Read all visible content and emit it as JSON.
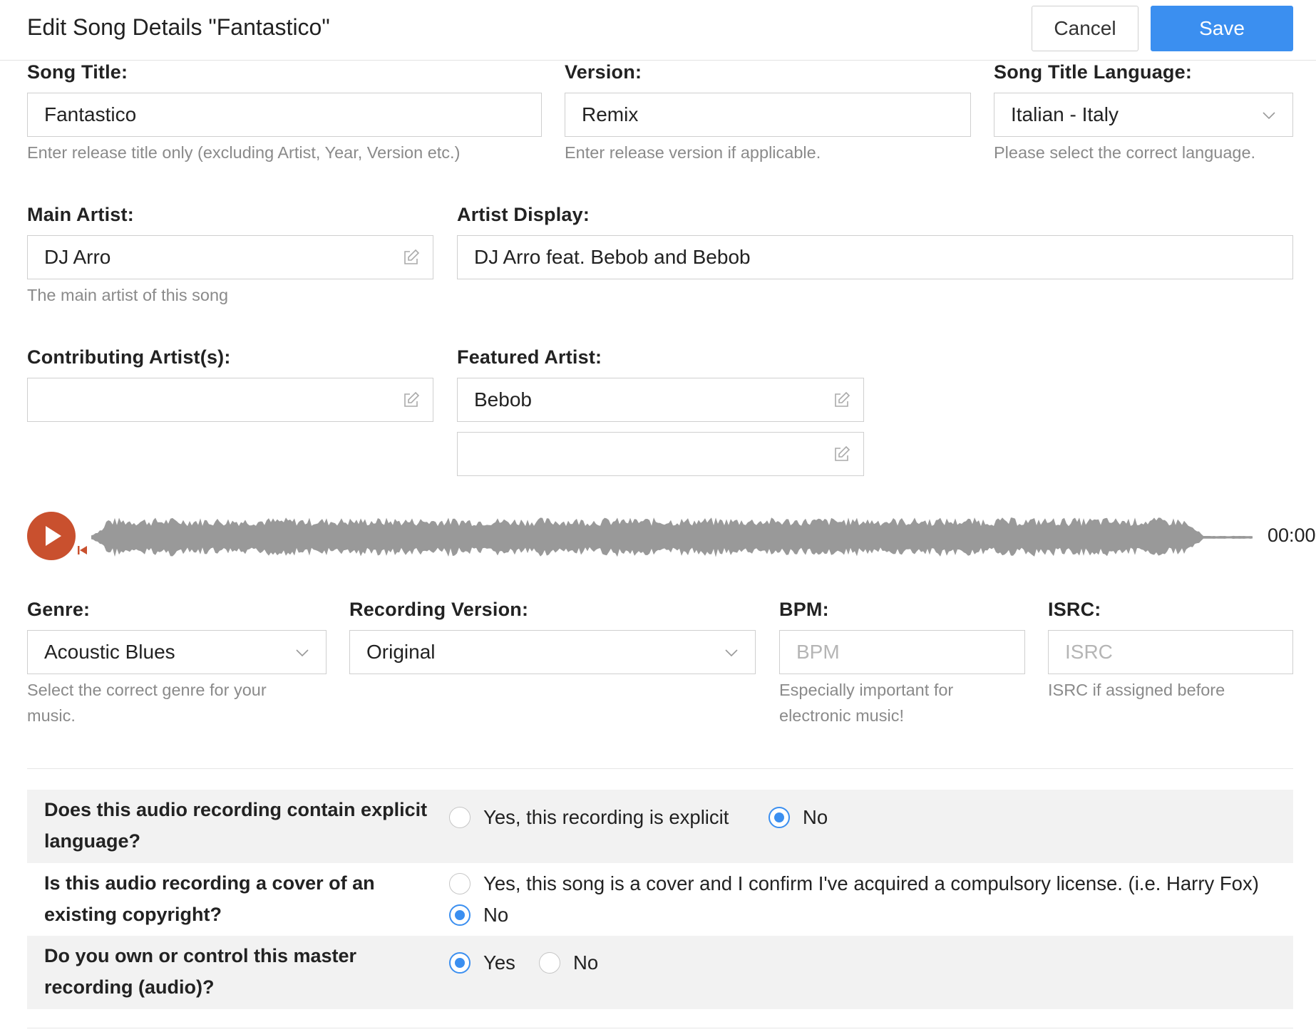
{
  "header": {
    "title": "Edit Song Details \"Fantastico\"",
    "cancel_label": "Cancel",
    "save_label": "Save"
  },
  "song_title": {
    "label": "Song Title:",
    "value": "Fantastico",
    "help": "Enter release title only (excluding Artist, Year, Version etc.)"
  },
  "version": {
    "label": "Version:",
    "value": "Remix",
    "help": "Enter release version if applicable."
  },
  "language": {
    "label": "Song Title Language:",
    "value": "Italian - Italy",
    "help": "Please select the correct language."
  },
  "main_artist": {
    "label": "Main Artist:",
    "value": "DJ Arro",
    "help": "The main artist of this song"
  },
  "artist_display": {
    "label": "Artist Display:",
    "value": "DJ Arro feat. Bebob and Bebob"
  },
  "contributing": {
    "label": "Contributing Artist(s):",
    "value": ""
  },
  "featured": {
    "label": "Featured Artist:",
    "values": [
      "Bebob",
      ""
    ]
  },
  "player": {
    "time": "00:00",
    "colors": {
      "play": "#c9502e",
      "wave": "#999999"
    }
  },
  "genre": {
    "label": "Genre:",
    "value": "Acoustic Blues",
    "help_line1": "Select the correct genre for your",
    "help_line2": "music."
  },
  "recording_version": {
    "label": "Recording Version:",
    "value": "Original"
  },
  "bpm": {
    "label": "BPM:",
    "placeholder": "BPM",
    "help_line1": "Especially important for",
    "help_line2": "electronic music!"
  },
  "isrc": {
    "label": "ISRC:",
    "placeholder": "ISRC",
    "help": "ISRC if assigned before"
  },
  "questions": {
    "explicit": {
      "line1": "Does this audio recording contain explicit",
      "line2": "language?",
      "opt_yes": "Yes, this recording is explicit",
      "opt_no": "No",
      "selected": "no"
    },
    "cover": {
      "line1": "Is this audio recording a cover of an",
      "line2": "existing copyright?",
      "opt_yes": "Yes, this song is a cover and I confirm I've acquired a compulsory license. (i.e. Harry Fox)",
      "opt_no": "No",
      "selected": "no"
    },
    "master": {
      "line1": "Do you own or control this master",
      "line2": "recording (audio)?",
      "opt_yes": "Yes",
      "opt_no": "No",
      "selected": "yes"
    }
  },
  "accent_color": "#3b8ff0"
}
